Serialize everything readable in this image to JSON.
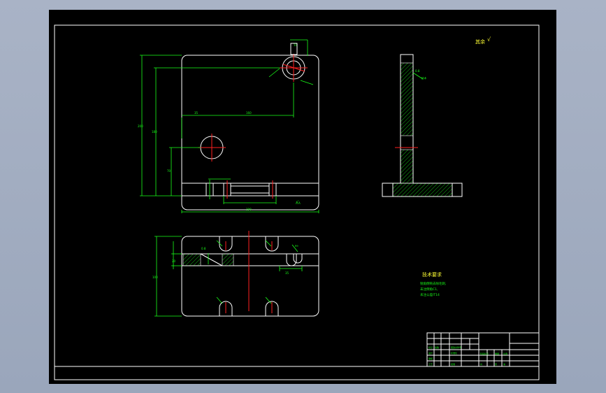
{
  "drawing": {
    "roughness_symbol": "其余",
    "tech_title": "技术要求",
    "tech_notes": [
      "锐角倒钝去除毛刺,",
      "未注倒角C1,",
      "未注公差IT14"
    ],
    "section_label": "A-A"
  },
  "colors": {
    "background": "#000000",
    "outline": "#ffffff",
    "dimension": "#19ff19",
    "centerline": "#ff2020",
    "hatch": "#19ff19"
  }
}
